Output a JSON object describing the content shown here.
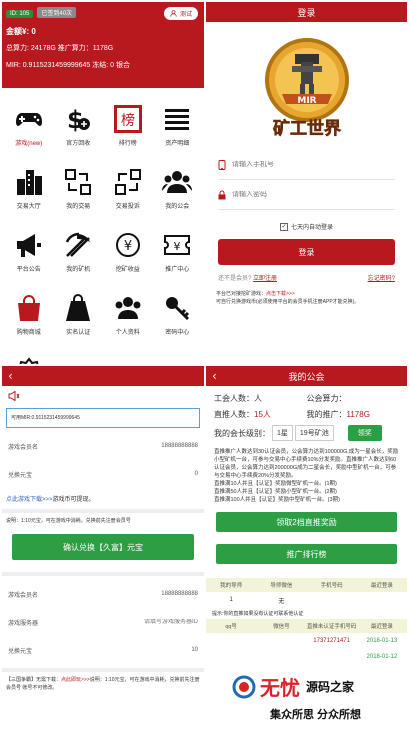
{
  "home": {
    "id_badge": "ID: 105",
    "member_badge": "已签到40次",
    "test_btn": "测试",
    "gold": "金额¥: 0",
    "power": "总算力: 24178G 推广算力：1178G",
    "mir_line": "MIR: 0.9115231459999645 冻结: 0 银合",
    "grid": [
      {
        "label": "游戏(new)",
        "icon": "gamepad-icon",
        "accent": true
      },
      {
        "label": "官方回收",
        "icon": "recycle-money-icon"
      },
      {
        "label": "排行榜",
        "icon": "ranking-badge-icon",
        "char": "榜"
      },
      {
        "label": "资产明细",
        "icon": "list-lines-icon"
      },
      {
        "label": "交易大厅",
        "icon": "buildings-icon"
      },
      {
        "label": "我的交易",
        "icon": "exchange-arrows-icon"
      },
      {
        "label": "交易投诉",
        "icon": "complaint-arrows-icon"
      },
      {
        "label": "我的公会",
        "icon": "group-people-icon"
      },
      {
        "label": "平台公告",
        "icon": "megaphone-icon"
      },
      {
        "label": "我的矿机",
        "icon": "pickaxe-icon"
      },
      {
        "label": "挖矿收益",
        "icon": "yen-coin-icon"
      },
      {
        "label": "推广中心",
        "icon": "ticket-yen-icon"
      },
      {
        "label": "购物商城",
        "icon": "shopping-bag-icon"
      },
      {
        "label": "实名认证",
        "icon": "id-card-icon"
      },
      {
        "label": "个人资料",
        "icon": "people-icon"
      },
      {
        "label": "密码中心",
        "icon": "key-icon"
      },
      {
        "label": "",
        "icon": "settings-gear-icon"
      }
    ]
  },
  "login": {
    "title": "登录",
    "logo_text": "MIR",
    "logo_caption": "矿工世界",
    "phone_placeholder": "请输入手机号",
    "password_placeholder": "请输入密码",
    "auto_login": "七天内自动登录",
    "login_btn": "登录",
    "register_prefix": "还不是会员?",
    "register_link": "立即注册",
    "forgot": "忘记密码?",
    "note_prefix": "平台已对接挖矿游戏：",
    "note_link": "点击下载>>>",
    "note_rest": "可自行兑换游戏币(必须使用平台的会员手机注册APP才能兑换)。"
  },
  "exchange": {
    "mir_info": "可用MIR:0.9115231459999645",
    "account_label": "游戏会员名",
    "account_value": "18888888888",
    "exchange_label": "兑换元宝",
    "exchange_value": "0",
    "download_text": "点此游戏下载>>>",
    "download_rest": "游戏币可提现。",
    "rate_note": "说明：1:10元宝，可在游戏中消耗。兑换前先注册会员号",
    "confirm_btn": "确认兑换【久富】元宝",
    "account_label2": "游戏会员名",
    "account_value2": "18888888888",
    "server_label": "游戏服务器",
    "server_placeholder": "请填写游戏服务器ID",
    "exchange_label2": "兑换元宝",
    "exchange_value2": "10",
    "bottom_note_prefix": "【三国争霸】无需下载：",
    "bottom_note_link": "点此即玩>>>",
    "bottom_note_rest": "说明：1:10元宝，可在游戏中消耗，兑换前先注册会员号 账号不可修改。"
  },
  "guild": {
    "title": "我的公会",
    "members_label": "工会人数：",
    "members_value": "人",
    "power_label": "公会算力：",
    "direct_label": "直推人数：",
    "direct_value": "15人",
    "promo_label": "我的推广：",
    "promo_value": "1178G",
    "level_label": "我的会长级别：",
    "level_star": "1星",
    "level_machine": "19号矿池",
    "level_btn": "领奖",
    "desc": "直推推广人数达到30认证会员，公会算力达到100000G,成为一星会长，奖励小型矿机一台，可参与交易中心手续费10%分发奖励。直推推广人数达到60认证会员，公会算力达到200000G成为二星会长，奖励中型矿机一台，可参与交易中心手续费20%分发奖励。",
    "desc_list": [
      "直推满10人并且【认证】奖励微型矿机一台。(1期)",
      "直推满50人并且【认证】奖励小型矿机一台。(2期)",
      "直推满100人并且【认证】奖励中型矿机一台。(3期)"
    ],
    "claim_btn": "领取2档直推奖励",
    "rank_btn": "推广排行榜",
    "table1_headers": [
      "我的导师",
      "导师微信",
      "手机号码",
      "最近登录"
    ],
    "table1_row": [
      "1",
      "无",
      "",
      ""
    ],
    "table2_note": "提示:你的直推如果没有认证可联系他认证",
    "table2_headers": [
      "qq号",
      "微信号",
      "直推未认证手机号码",
      "最近登录"
    ],
    "table2_row": [
      "",
      "",
      "17371271471",
      "2018-01-13"
    ],
    "table3_row": [
      "",
      "",
      "",
      "2018-01-12"
    ]
  },
  "watermark": {
    "big": "无忧",
    "site": "源码之家",
    "slogan": "集众所思 分众所想"
  },
  "colors": {
    "brand": "#b8191f",
    "green": "#2e9e44"
  }
}
